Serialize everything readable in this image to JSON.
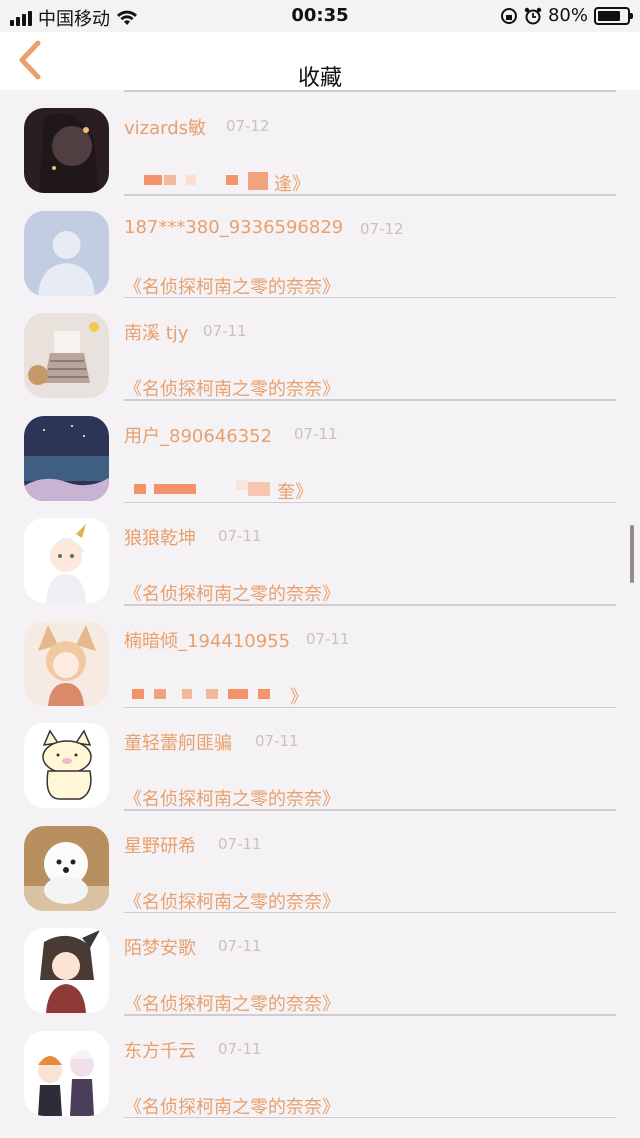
{
  "status_bar": {
    "carrier": "中国移动",
    "time": "00:35",
    "battery": "80%",
    "battery_level": 0.8
  },
  "nav": {
    "title": "收藏",
    "back_icon": "chevron-left-icon",
    "accent": "#e8a06c"
  },
  "items": [
    {
      "name": "vizards敏",
      "date": "07-12",
      "title": "逢》"
    },
    {
      "name": "187***380_9336596829",
      "date": "07-12",
      "title": "《名侦探柯南之零的奈奈》"
    },
    {
      "name": "南溪 tjy",
      "date": "07-11",
      "title": "《名侦探柯南之零的奈奈》"
    },
    {
      "name": "用户_890646352",
      "date": "07-11",
      "title": "奎》"
    },
    {
      "name": "狼狼乾坤",
      "date": "07-11",
      "title": "《名侦探柯南之零的奈奈》"
    },
    {
      "name": "楠暗倾_194410955",
      "date": "07-11",
      "title": "》"
    },
    {
      "name": "童轻蕾舸匪骗",
      "date": "07-11",
      "title": "《名侦探柯南之零的奈奈》"
    },
    {
      "name": "星野研希",
      "date": "07-11",
      "title": "《名侦探柯南之零的奈奈》"
    },
    {
      "name": "陌梦安歌",
      "date": "07-11",
      "title": "《名侦探柯南之零的奈奈》"
    },
    {
      "name": "东方千云",
      "date": "07-11",
      "title": "《名侦探柯南之零的奈奈》"
    }
  ]
}
